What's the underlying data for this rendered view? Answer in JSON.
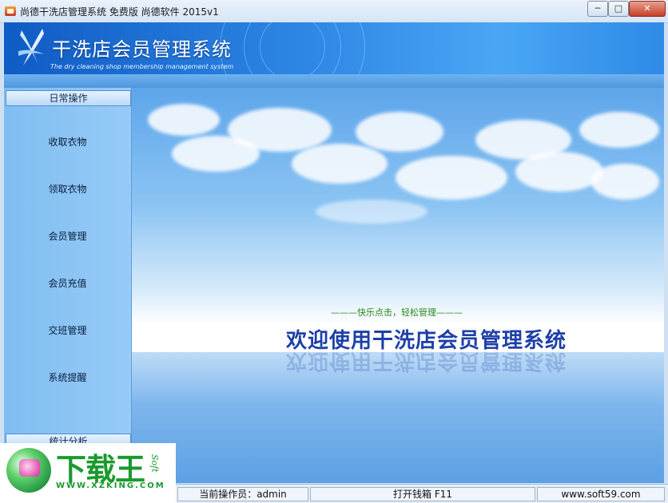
{
  "window": {
    "title": "尚德干洗店管理系统 免费版 尚德软件 2015v1",
    "minimize": "─",
    "maximize": "□",
    "close": "✕"
  },
  "banner": {
    "title": "干洗店会员管理系统",
    "subtitle": "The dry cleaning shop membership management system"
  },
  "sidebar": {
    "header": "日常操作",
    "items": [
      {
        "label": "收取衣物"
      },
      {
        "label": "领取衣物"
      },
      {
        "label": "会员管理"
      },
      {
        "label": "会员充值"
      },
      {
        "label": "交班管理"
      },
      {
        "label": "系统提醒"
      }
    ],
    "footer": "统计分析"
  },
  "main": {
    "tagline": "———快乐点击，轻松管理———",
    "welcome": "欢迎使用干洗店会员管理系统"
  },
  "status": {
    "operator": "当前操作员：admin",
    "open_drawer": "打开钱箱 F11",
    "website": "www.soft59.com"
  },
  "watermark": {
    "brand": "下载王",
    "soft": "Soft",
    "url": "WWW.XZKING.COM"
  }
}
